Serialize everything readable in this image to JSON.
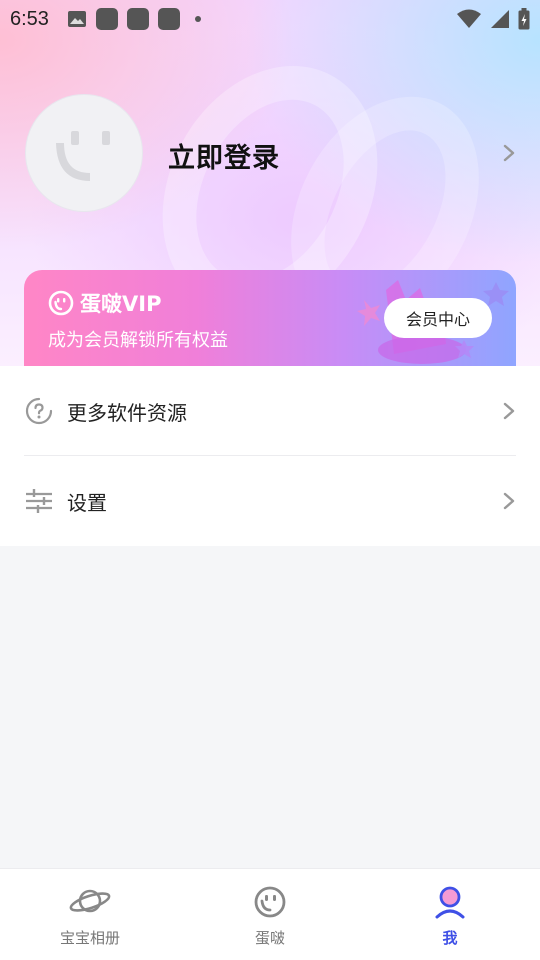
{
  "status_bar": {
    "time": "6:53"
  },
  "profile": {
    "login_label": "立即登录"
  },
  "vip": {
    "brand": "蛋啵VIP",
    "subtitle": "成为会员解锁所有权益",
    "button_label": "会员中心"
  },
  "menu": {
    "items": [
      {
        "label": "更多软件资源",
        "icon": "help-circle-icon"
      },
      {
        "label": "设置",
        "icon": "sliders-icon"
      }
    ]
  },
  "bottom_nav": {
    "items": [
      {
        "label": "宝宝相册",
        "icon": "planet-icon"
      },
      {
        "label": "蛋啵",
        "icon": "smiley-icon"
      },
      {
        "label": "我",
        "icon": "user-icon",
        "active": true
      }
    ]
  },
  "colors": {
    "accent": "#3f50e6",
    "vip_gradient_start": "#ff86c6",
    "vip_gradient_end": "#8fa5ff"
  }
}
